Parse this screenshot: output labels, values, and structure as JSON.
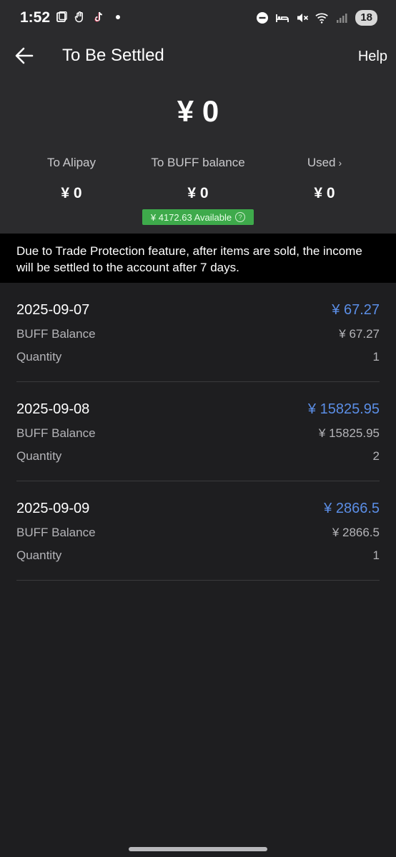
{
  "status_bar": {
    "time": "1:52",
    "battery": "18",
    "left_icons": [
      "screenshot-icon",
      "hand-icon",
      "tiktok-icon"
    ],
    "right_icons": [
      "dnd-icon",
      "bed-icon",
      "mute-icon",
      "wifi-icon",
      "signal-icon"
    ]
  },
  "header": {
    "title": "To Be Settled",
    "help_label": "Help"
  },
  "summary": {
    "total": "¥ 0",
    "columns": [
      {
        "label": "To Alipay",
        "value": "¥ 0"
      },
      {
        "label": "To BUFF balance",
        "value": "¥ 0"
      },
      {
        "label": "Used",
        "value": "¥ 0",
        "chevron": "›"
      }
    ],
    "available": "¥ 4172.63 Available"
  },
  "notice": "Due to Trade Protection feature, after items are sold, the income will be settled to the account after 7 days.",
  "records": [
    {
      "date": "2025-09-07",
      "total": "¥ 67.27",
      "balance_label": "BUFF Balance",
      "balance_value": "¥ 67.27",
      "quantity_label": "Quantity",
      "quantity_value": "1"
    },
    {
      "date": "2025-09-08",
      "total": "¥ 15825.95",
      "balance_label": "BUFF Balance",
      "balance_value": "¥ 15825.95",
      "quantity_label": "Quantity",
      "quantity_value": "2"
    },
    {
      "date": "2025-09-09",
      "total": "¥ 2866.5",
      "balance_label": "BUFF Balance",
      "balance_value": "¥ 2866.5",
      "quantity_label": "Quantity",
      "quantity_value": "1"
    }
  ],
  "colors": {
    "header_bg": "#2b2b2d",
    "page_bg": "#1e1e20",
    "accent_blue": "#5b8ee6",
    "available_green": "#3eaa4b",
    "notice_bg": "#000000"
  }
}
